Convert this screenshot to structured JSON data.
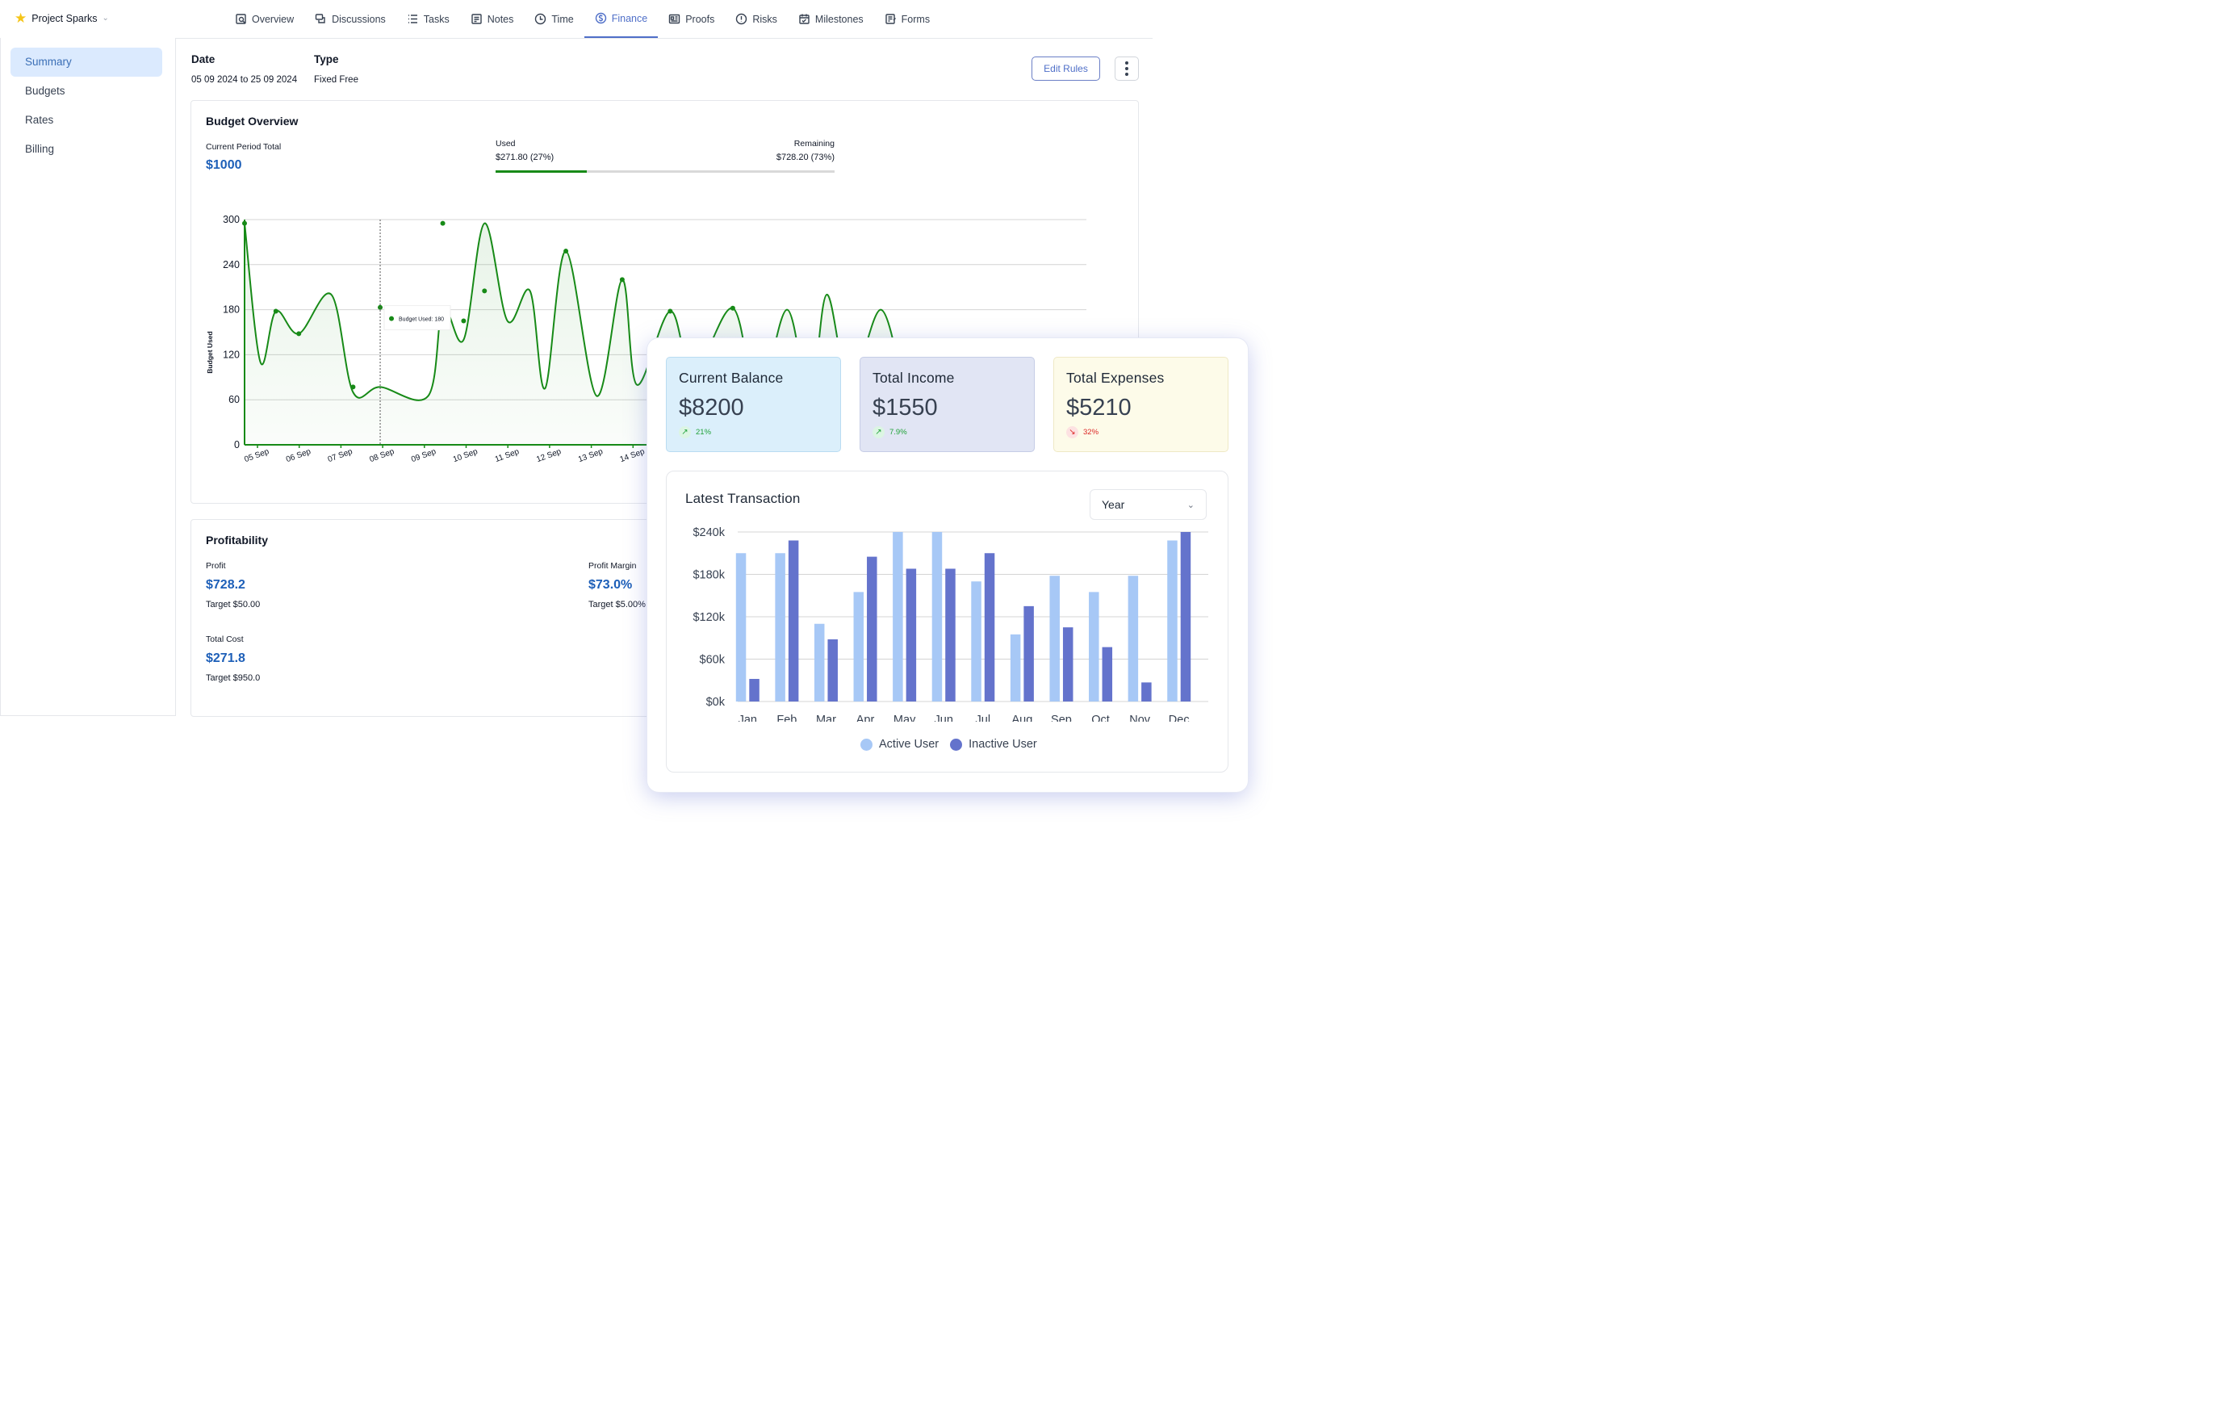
{
  "project": {
    "name": "Project Sparks"
  },
  "nav": [
    {
      "label": "Overview",
      "icon": "overview-icon"
    },
    {
      "label": "Discussions",
      "icon": "discussions-icon"
    },
    {
      "label": "Tasks",
      "icon": "tasks-icon"
    },
    {
      "label": "Notes",
      "icon": "notes-icon"
    },
    {
      "label": "Time",
      "icon": "clock-icon"
    },
    {
      "label": "Finance",
      "icon": "finance-icon",
      "active": true
    },
    {
      "label": "Proofs",
      "icon": "proofs-icon"
    },
    {
      "label": "Risks",
      "icon": "risks-icon"
    },
    {
      "label": "Milestones",
      "icon": "milestones-icon"
    },
    {
      "label": "Forms",
      "icon": "forms-icon"
    }
  ],
  "sidebar": {
    "items": [
      {
        "label": "Summary",
        "active": true
      },
      {
        "label": "Budgets"
      },
      {
        "label": "Rates"
      },
      {
        "label": "Billing"
      }
    ]
  },
  "header": {
    "date_label": "Date",
    "date_value": "05 09 2024 to 25 09 2024",
    "type_label": "Type",
    "type_value": "Fixed Free",
    "edit_rules": "Edit Rules"
  },
  "budget": {
    "title": "Budget Overview",
    "period_label": "Current Period Total",
    "period_value": "$1000",
    "used_label": "Used",
    "used_value": "$271.80 (27%)",
    "remaining_label": "Remaining",
    "remaining_value": "$728.20 (73%)",
    "used_fraction": 0.27,
    "tooltip": "Budget Used: 180"
  },
  "profitability": {
    "title": "Profitability",
    "profit_label": "Profit",
    "profit_value": "$728.2",
    "profit_target": "Target $50.00",
    "margin_label": "Profit Margin",
    "margin_value": "$73.0%",
    "margin_target": "Target $5.00%",
    "cost_label": "Total Cost",
    "cost_value": "$271.8",
    "cost_target": "Target $950.0"
  },
  "stats": [
    {
      "title": "Current Balance",
      "value": "$8200",
      "change": "21%",
      "direction": "up",
      "bg": "#dbeffb",
      "border": "#b9dcf2"
    },
    {
      "title": "Total Income",
      "value": "$1550",
      "change": "7.9%",
      "direction": "up",
      "bg": "#e1e5f4",
      "border": "#c5cce6"
    },
    {
      "title": "Total Expenses",
      "value": "$5210",
      "change": "32%",
      "direction": "down",
      "bg": "#fdfbe9",
      "border": "#efe9c6"
    }
  ],
  "transactions": {
    "title": "Latest Transaction",
    "period": "Year",
    "legend_active": "Active User",
    "legend_inactive": "Inactive User"
  },
  "colors": {
    "accent": "#4f6fc8",
    "line": "#178a17",
    "active_bar": "#a7c8f6",
    "inactive_bar": "#6473cc",
    "up": "#22a33a",
    "down": "#dc2626"
  },
  "chart_data": [
    {
      "type": "line",
      "title": "",
      "xlabel": "",
      "ylabel": "Budget Used",
      "categories": [
        "05 Sep",
        "06 Sep",
        "07 Sep",
        "08 Sep",
        "09 Sep",
        "10 Sep",
        "11 Sep",
        "12 Sep",
        "13 Sep",
        "14 Sep"
      ],
      "yticks": [
        "0",
        "60",
        "120",
        "180",
        "240",
        "300"
      ],
      "ylim": [
        0,
        300
      ],
      "grid": true,
      "x": [
        0,
        0.38,
        0.75,
        1.3,
        2.08,
        2.6,
        3.25,
        4.4,
        4.75,
        5.25,
        5.75,
        6.3,
        6.84,
        7.2,
        7.7,
        8.44,
        9.05,
        9.4,
        10.2,
        10.75,
        11.7,
        12.3,
        13.0,
        13.55,
        13.95,
        14.5,
        15.25,
        15.8
      ],
      "values": [
        295,
        110,
        178,
        148,
        200,
        70,
        77,
        65,
        183,
        140,
        295,
        165,
        205,
        75,
        258,
        65,
        220,
        80,
        178,
        95,
        182,
        60,
        180,
        60,
        200,
        80,
        180,
        70
      ],
      "markers": [
        [
          0,
          295
        ],
        [
          0.75,
          178
        ],
        [
          1.3,
          148
        ],
        [
          2.6,
          77
        ],
        [
          3.25,
          183
        ],
        [
          4.75,
          295
        ],
        [
          5.25,
          165
        ],
        [
          5.75,
          205
        ],
        [
          7.7,
          258
        ],
        [
          9.05,
          220
        ],
        [
          10.2,
          178
        ],
        [
          11.7,
          182
        ]
      ],
      "highlight": {
        "x": 3.25,
        "value": 180
      }
    },
    {
      "type": "bar",
      "title": "",
      "categories": [
        "Jan",
        "Feb",
        "Mar",
        "Apr",
        "May",
        "Jun",
        "Jul",
        "Aug",
        "Sep",
        "Oct",
        "Nov",
        "Dec"
      ],
      "yticks": [
        "$0k",
        "$60k",
        "$120k",
        "$180k",
        "$240k"
      ],
      "ylim": [
        0,
        240
      ],
      "series": [
        {
          "name": "Active User",
          "values": [
            210,
            210,
            110,
            155,
            240,
            240,
            170,
            95,
            178,
            155,
            178,
            228
          ]
        },
        {
          "name": "Inactive User",
          "values": [
            32,
            228,
            88,
            205,
            188,
            188,
            210,
            135,
            105,
            77,
            27,
            240
          ]
        }
      ]
    }
  ]
}
